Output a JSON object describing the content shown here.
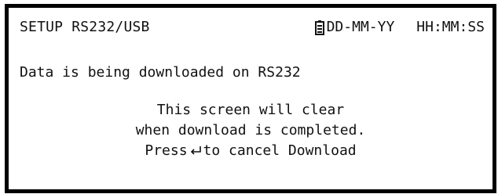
{
  "header": {
    "title": "SETUP RS232/USB",
    "date_format": "DD-MM-YY",
    "time_format": "HH:MM:SS",
    "battery_icon": "battery-icon"
  },
  "message": "Data is being downloaded on RS232",
  "info": {
    "line1": "This screen will clear",
    "line2": "when download is completed.",
    "line3_prefix": "Press",
    "line3_icon": "enter-key-icon",
    "line3_suffix": "to cancel Download"
  }
}
